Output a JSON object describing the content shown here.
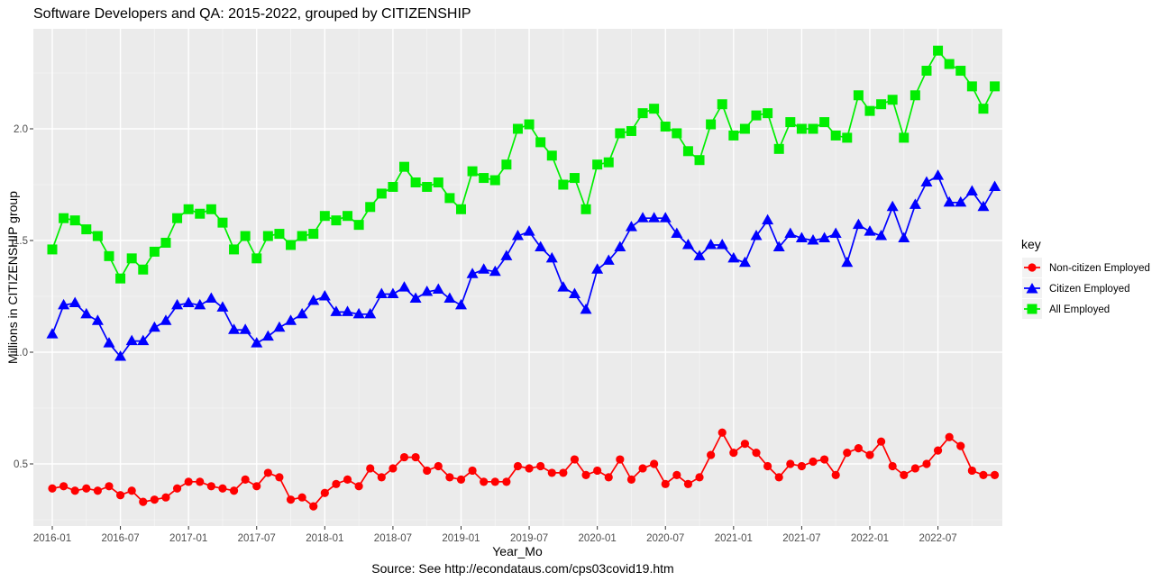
{
  "chart_data": {
    "type": "line",
    "title": "Software Developers and QA: 2015-2022, grouped by CITIZENSHIP",
    "xlabel": "Year_Mo",
    "ylabel": "Millions in CITIZENSHIP group",
    "caption": "Source: See http://econdataus.com/cps03covid19.htm",
    "x_start": "2016-01",
    "x_tick_labels": [
      "2016-01",
      "2016-07",
      "2017-01",
      "2017-07",
      "2018-01",
      "2018-07",
      "2019-01",
      "2019-07",
      "2020-01",
      "2020-07",
      "2021-01",
      "2021-07",
      "2022-01",
      "2022-07"
    ],
    "y_ticks": [
      0.5,
      1.0,
      1.5,
      2.0
    ],
    "y_tick_labels": [
      "0.5",
      "1.0",
      "1.5",
      "2.0"
    ],
    "ylim": [
      0.28,
      2.39
    ],
    "grid": true,
    "legend": {
      "title": "key",
      "position": "right"
    },
    "series": [
      {
        "name": "Non-citizen Employed",
        "color": "#ff0000",
        "marker": "circle",
        "values": [
          0.39,
          0.4,
          0.38,
          0.39,
          0.38,
          0.4,
          0.36,
          0.38,
          0.33,
          0.34,
          0.35,
          0.39,
          0.42,
          0.42,
          0.4,
          0.39,
          0.38,
          0.43,
          0.4,
          0.46,
          0.44,
          0.34,
          0.35,
          0.31,
          0.37,
          0.41,
          0.43,
          0.4,
          0.48,
          0.44,
          0.48,
          0.53,
          0.53,
          0.47,
          0.49,
          0.44,
          0.43,
          0.47,
          0.42,
          0.42,
          0.42,
          0.49,
          0.48,
          0.49,
          0.46,
          0.46,
          0.52,
          0.45,
          0.47,
          0.44,
          0.52,
          0.43,
          0.48,
          0.5,
          0.41,
          0.45,
          0.41,
          0.44,
          0.54,
          0.64,
          0.55,
          0.59,
          0.55,
          0.49,
          0.44,
          0.5,
          0.49,
          0.51,
          0.52,
          0.45,
          0.55,
          0.57,
          0.54,
          0.6,
          0.49,
          0.45,
          0.48,
          0.5,
          0.56,
          0.62,
          0.58,
          0.47,
          0.45,
          0.45
        ]
      },
      {
        "name": "Citizen Employed",
        "color": "#0000ff",
        "marker": "triangle",
        "values": [
          1.08,
          1.21,
          1.22,
          1.17,
          1.14,
          1.04,
          0.98,
          1.05,
          1.05,
          1.11,
          1.14,
          1.21,
          1.22,
          1.21,
          1.24,
          1.2,
          1.1,
          1.1,
          1.04,
          1.07,
          1.11,
          1.14,
          1.17,
          1.23,
          1.25,
          1.18,
          1.18,
          1.17,
          1.17,
          1.26,
          1.26,
          1.29,
          1.24,
          1.27,
          1.28,
          1.24,
          1.21,
          1.35,
          1.37,
          1.36,
          1.43,
          1.52,
          1.54,
          1.47,
          1.42,
          1.29,
          1.26,
          1.19,
          1.37,
          1.41,
          1.47,
          1.56,
          1.6,
          1.6,
          1.6,
          1.53,
          1.48,
          1.43,
          1.48,
          1.48,
          1.42,
          1.4,
          1.52,
          1.59,
          1.47,
          1.53,
          1.51,
          1.5,
          1.51,
          1.53,
          1.4,
          1.57,
          1.54,
          1.52,
          1.65,
          1.51,
          1.66,
          1.76,
          1.79,
          1.67,
          1.67,
          1.72,
          1.65,
          1.74
        ]
      },
      {
        "name": "All Employed",
        "color": "#00ee00",
        "marker": "square",
        "values": [
          1.46,
          1.6,
          1.59,
          1.55,
          1.52,
          1.43,
          1.33,
          1.42,
          1.37,
          1.45,
          1.49,
          1.6,
          1.64,
          1.62,
          1.64,
          1.58,
          1.46,
          1.52,
          1.42,
          1.52,
          1.53,
          1.48,
          1.52,
          1.53,
          1.61,
          1.59,
          1.61,
          1.57,
          1.65,
          1.71,
          1.74,
          1.83,
          1.76,
          1.74,
          1.76,
          1.69,
          1.64,
          1.81,
          1.78,
          1.77,
          1.84,
          2.0,
          2.02,
          1.94,
          1.88,
          1.75,
          1.78,
          1.64,
          1.84,
          1.85,
          1.98,
          1.99,
          2.07,
          2.09,
          2.01,
          1.98,
          1.9,
          1.86,
          2.02,
          2.11,
          1.97,
          2.0,
          2.06,
          2.07,
          1.91,
          2.03,
          2.0,
          2.0,
          2.03,
          1.97,
          1.96,
          2.15,
          2.08,
          2.11,
          2.13,
          1.96,
          2.15,
          2.26,
          2.35,
          2.29,
          2.26,
          2.19,
          2.09,
          2.19
        ]
      }
    ]
  }
}
